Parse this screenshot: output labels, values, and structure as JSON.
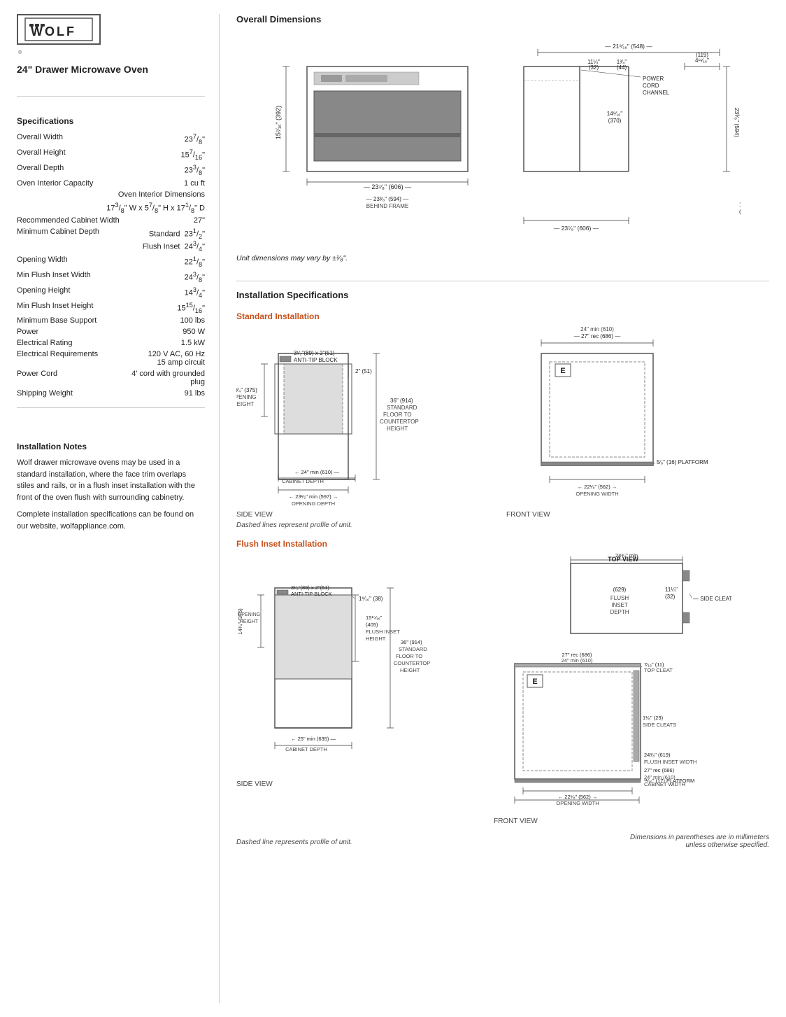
{
  "brand": {
    "logo_text": "WOLF",
    "registered": "®"
  },
  "product": {
    "title": "24\"  Drawer Microwave Oven"
  },
  "specs_title": "Specifications",
  "specs": [
    {
      "label": "Overall Width",
      "value": "23⁷⁄₈\""
    },
    {
      "label": "Overall Height",
      "value": "15⁷⁄₁₆\""
    },
    {
      "label": "Overall Depth",
      "value": "23³⁄₈\""
    },
    {
      "label": "Oven Interior Capacity",
      "value": "1 cu ft"
    },
    {
      "label": "Oven Interior Dimensions",
      "value": "17³⁄₈\" W x 5⁷⁄₈\" H x 17¹⁄₈\" D"
    },
    {
      "label": "Recommended Cabinet Width",
      "value": "27\""
    },
    {
      "label": "Minimum Cabinet Depth",
      "value": "Standard  23¹⁄₂\"\nFlush Inset  24³⁄₄\""
    },
    {
      "label": "Opening Width",
      "value": "22¹⁄₈\""
    },
    {
      "label": "Min Flush Inset Width",
      "value": "24³⁄₈\""
    },
    {
      "label": "Opening Height",
      "value": "14³⁄₄\""
    },
    {
      "label": "Min Flush Inset Height",
      "value": "15¹⁵⁄₁₆\""
    },
    {
      "label": "Minimum Base Support",
      "value": "100 lbs"
    },
    {
      "label": "Power",
      "value": "950 W"
    },
    {
      "label": "Electrical Rating",
      "value": "1.5 kW"
    },
    {
      "label": "Electrical Requirements",
      "value": "120 V AC, 60 Hz\n15 amp circuit"
    },
    {
      "label": "Power Cord",
      "value": "4' cord with grounded plug"
    },
    {
      "label": "Shipping Weight",
      "value": "91 lbs"
    }
  ],
  "install_notes_title": "Installation Notes",
  "install_notes": [
    "Wolf drawer microwave ovens may be used in a standard installation, where the face trim overlaps stiles and rails, or in a flush inset installation with the front of the oven flush with surrounding cabinetry.",
    "Complete installation specifications can be found on our website, wolfappliance.com."
  ],
  "overall_dimensions_title": "Overall Dimensions",
  "unit_note": "Unit dimensions may vary by ±¹⁄₈\".",
  "install_specs_title": "Installation Specifications",
  "standard_install_title": "Standard Installation",
  "flush_install_title": "Flush Inset Installation",
  "side_view_label": "SIDE VIEW",
  "front_view_label": "FRONT VIEW",
  "dashed_note_1": "Dashed lines represent profile of unit.",
  "dashed_note_2": "Dashed line represents profile of unit.",
  "bottom_note": "Dimensions in parentheses are in millimeters unless otherwise specified."
}
